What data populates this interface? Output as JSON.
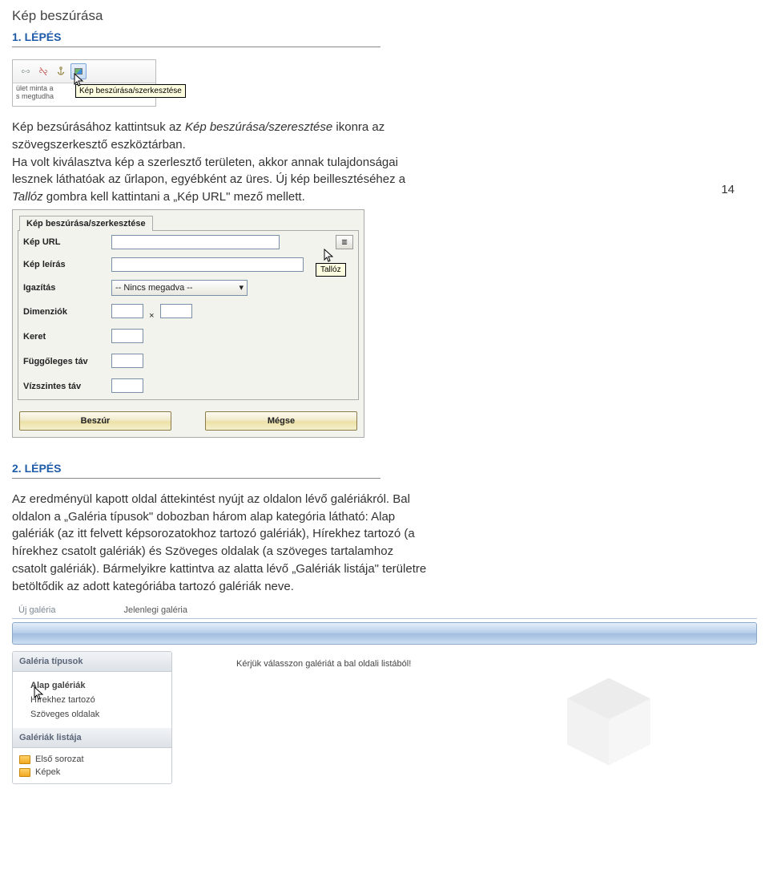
{
  "page": {
    "title": "Kép beszúrása",
    "number": "14"
  },
  "step1": {
    "title": "1. LÉPÉS",
    "text_a": "Kép bezsúrásához kattintsuk az ",
    "text_em1": "Kép beszúrása/szeresztése",
    "text_b": " ikonra az szövegszerkesztő eszköztárban.",
    "text_c": "Ha volt kiválasztva kép a szerlesztő területen, akkor annak tulajdonságai lesznek láthatóak az űrlapon, egyébként az üres. Új kép beillesztéséhez a ",
    "text_em2": "Tallóz",
    "text_d": " gombra kell kattintani a „Kép URL\" mező mellett."
  },
  "ss1": {
    "tooltip": "Kép beszúrása/szerkesztése",
    "body_line1": "ület minta a",
    "body_line2": "s megtudha"
  },
  "ss2": {
    "tab": "Kép beszúrása/szerkesztése",
    "labels": {
      "url": "Kép URL",
      "desc": "Kép leírás",
      "align": "Igazítás",
      "dim": "Dimenziók",
      "border": "Keret",
      "vspace": "Függőleges táv",
      "hspace": "Vízszintes táv"
    },
    "align_value": "-- Nincs megadva --",
    "dim_x": "×",
    "tooltip": "Tallóz",
    "btn_insert": "Beszúr",
    "btn_cancel": "Mégse"
  },
  "step2": {
    "title": "2. LÉPÉS",
    "text": "Az eredményül kapott oldal áttekintést nyújt az oldalon lévő galériákról. Bal oldalon a „Galéria típusok\" dobozban három alap  kategória látható: Alap galériák (az itt felvett képsorozatokhoz tartozó galériák), Hírekhez tartozó (a hírekhez csatolt galériák) és Szöveges oldalak (a szöveges tartalamhoz csatolt galériák). Bármelyikre kattintva az alatta lévő „Galériák listája\" területre betöltődik az adott kategóriába tartozó galériák neve."
  },
  "ss3": {
    "tabs": {
      "new": "Új galéria",
      "current": "Jelenlegi galéria"
    },
    "side1_title": "Galéria típusok",
    "side1_items": [
      "Alap galériák",
      "Hírekhez tartozó",
      "Szöveges oldalak"
    ],
    "side2_title": "Galériák listája",
    "side2_items": [
      "Első sorozat",
      "Képek"
    ],
    "message": "Kérjük válasszon galériát a bal oldali listából!"
  }
}
